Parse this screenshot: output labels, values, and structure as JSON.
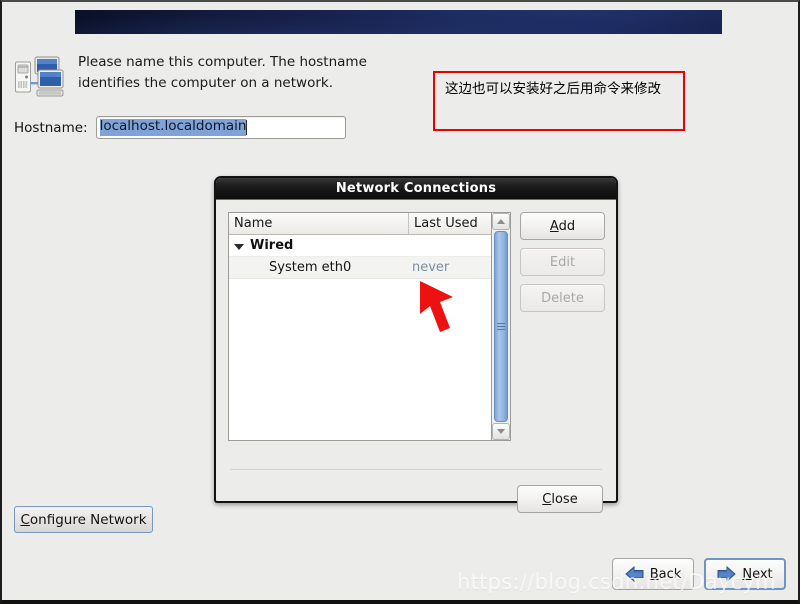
{
  "window": {
    "banner_color": "#16204c"
  },
  "intro": {
    "icon": "computer-network-icon",
    "text": "Please name this computer.  The hostname identifies the computer on a network."
  },
  "hostname": {
    "label": "Hostname:",
    "value": "localhost.localdomain",
    "placeholder": "localhost.localdomain",
    "selected": true,
    "selection_color": "#7fa3d6"
  },
  "annotation": {
    "text": "这边也可以安装好之后用命令来修改",
    "border_color": "#ee0000"
  },
  "dialog": {
    "title": "Network Connections",
    "columns": [
      "Name",
      "Last Used"
    ],
    "groups": [
      {
        "label": "Wired",
        "expanded": true,
        "rows": [
          {
            "name": "System eth0",
            "last_used": "never"
          }
        ]
      }
    ],
    "buttons": {
      "add": {
        "label": "Add",
        "mnemonic": "A",
        "enabled": true
      },
      "edit": {
        "label": "Edit",
        "enabled": false
      },
      "delete": {
        "label": "Delete",
        "enabled": false
      },
      "close": {
        "label": "Close",
        "mnemonic": "C",
        "enabled": true
      }
    },
    "scrollbar": {
      "orientation": "vertical",
      "thumb_color": "#8fb2de",
      "position": 0
    }
  },
  "configure": {
    "label": "Configure Network",
    "mnemonic": "C"
  },
  "nav": {
    "back": {
      "label": "Back",
      "mnemonic": "B",
      "icon": "arrow-left-icon"
    },
    "next": {
      "label": "Next",
      "mnemonic": "N",
      "icon": "arrow-right-icon",
      "focused": true
    }
  },
  "watermark": {
    "text": "https://blog.csdn.net/Daycym"
  }
}
